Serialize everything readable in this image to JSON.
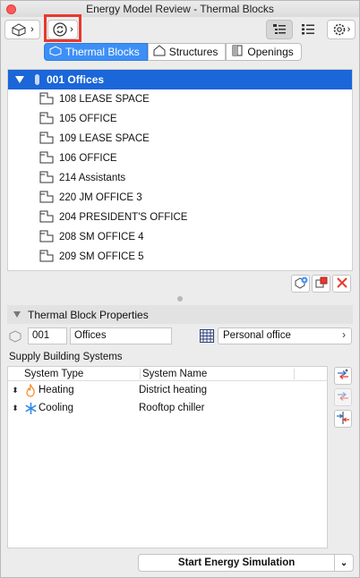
{
  "window": {
    "title": "Energy Model Review - Thermal Blocks"
  },
  "toolbar": {
    "icons": [
      "model-icon",
      "chevron-right-icon",
      "refresh-icon",
      "chevron-right-icon",
      "list-view-icon",
      "detail-list-icon",
      "settings-icon"
    ]
  },
  "tabs": [
    {
      "label": "Thermal Blocks",
      "active": true
    },
    {
      "label": "Structures",
      "active": false
    },
    {
      "label": "Openings",
      "active": false
    }
  ],
  "tree": {
    "root": {
      "label": "001 Offices"
    },
    "items": [
      {
        "label": "108 LEASE SPACE"
      },
      {
        "label": "105 OFFICE"
      },
      {
        "label": "109 LEASE SPACE"
      },
      {
        "label": "106 OFFICE"
      },
      {
        "label": "214 Assistants"
      },
      {
        "label": "220 JM OFFICE 3"
      },
      {
        "label": "204 PRESIDENT'S OFFICE"
      },
      {
        "label": "208 SM OFFICE 4"
      },
      {
        "label": "209 SM OFFICE 5"
      }
    ]
  },
  "properties": {
    "title": "Thermal Block Properties",
    "id_value": "001",
    "name_value": "Offices",
    "profile": "Personal office"
  },
  "supply": {
    "title": "Supply Building Systems",
    "columns": {
      "type": "System Type",
      "name": "System Name"
    },
    "rows": [
      {
        "type": "Heating",
        "name": "District heating",
        "icon": "flame-icon"
      },
      {
        "type": "Cooling",
        "name": "Rooftop chiller",
        "icon": "snowflake-icon"
      }
    ]
  },
  "actions": {
    "start": "Start Energy Simulation"
  },
  "colors": {
    "accent": "#3d8ff6",
    "selection": "#1b66d8",
    "highlight": "#e8382c",
    "close": "#fc5b57"
  }
}
